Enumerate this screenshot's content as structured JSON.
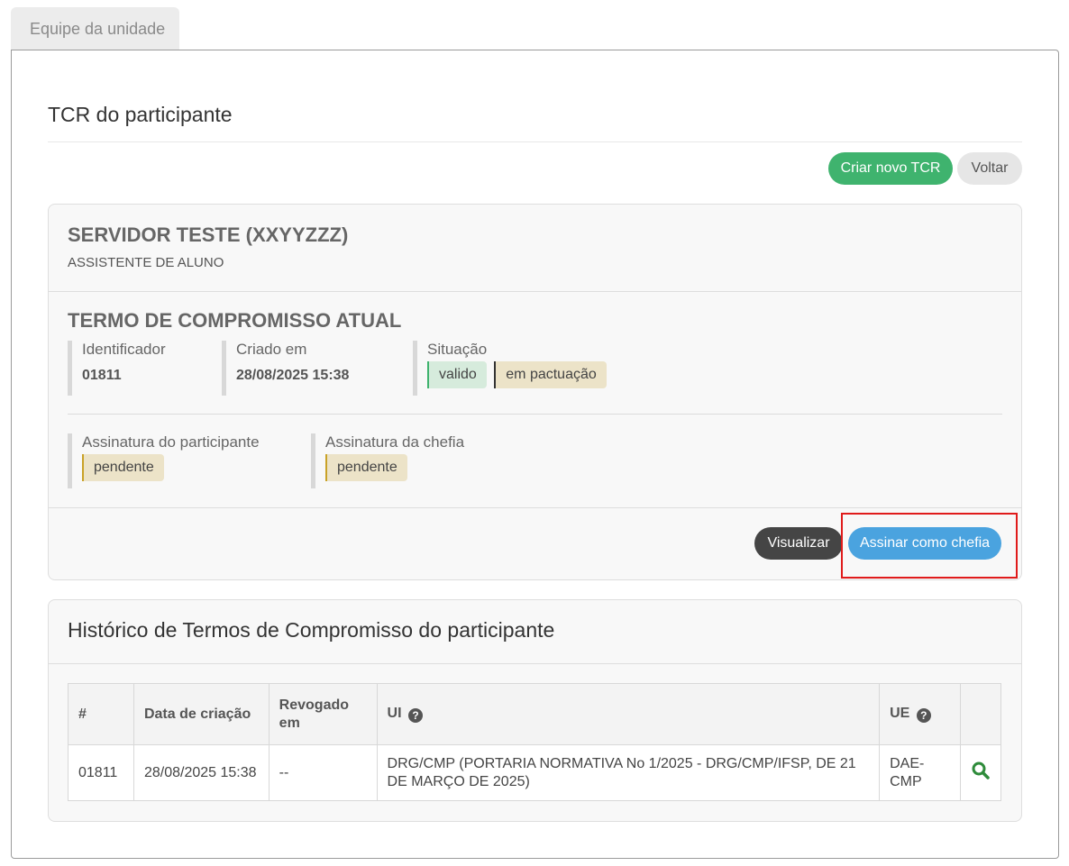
{
  "tab": {
    "label": "Equipe da unidade"
  },
  "page": {
    "title": "TCR do participante"
  },
  "actions": {
    "create_label": "Criar novo TCR",
    "back_label": "Voltar"
  },
  "participant": {
    "name": "SERVIDOR TESTE (XXYYZZZ)",
    "role": "ASSISTENTE DE ALUNO"
  },
  "term": {
    "title": "TERMO DE COMPROMISSO ATUAL",
    "identifier_label": "Identificador",
    "identifier_value": "01811",
    "created_label": "Criado em",
    "created_value": "28/08/2025 15:38",
    "status_label": "Situação",
    "status_badges": [
      "valido",
      "em pactuação"
    ],
    "participant_signature_label": "Assinatura do participante",
    "participant_signature_value": "pendente",
    "manager_signature_label": "Assinatura da chefia",
    "manager_signature_value": "pendente",
    "view_label": "Visualizar",
    "sign_label": "Assinar como chefia"
  },
  "history": {
    "title": "Histórico de Termos de Compromisso do participante",
    "columns": [
      "#",
      "Data de criação",
      "Revogado em",
      "UI",
      "UE",
      ""
    ],
    "rows": [
      {
        "id": "01811",
        "created": "28/08/2025 15:38",
        "revoked": "--",
        "ui": "DRG/CMP (PORTARIA NORMATIVA No 1/2025 - DRG/CMP/IFSP, DE 21 DE MARÇO DE 2025)",
        "ue": "DAE-CMP",
        "action_icon": "search-icon"
      }
    ]
  },
  "colors": {
    "green": "#3fb36e",
    "blue": "#4aa3df",
    "dark": "#454545",
    "highlight": "#e01b1b",
    "badge_tan": "#ece3c8",
    "badge_green": "#d6ebdc"
  }
}
